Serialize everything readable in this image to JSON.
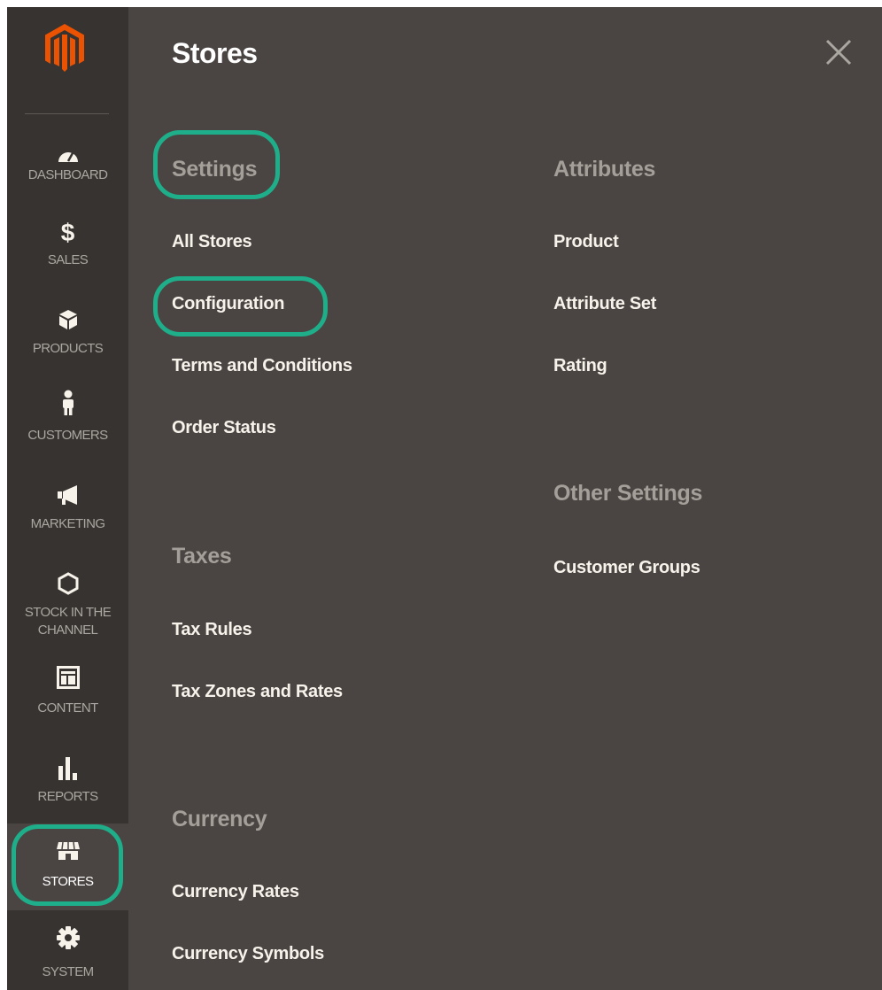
{
  "sidebar": {
    "logo_name": "magento-logo",
    "items": [
      {
        "label": "DASHBOARD",
        "icon": "dashboard-icon"
      },
      {
        "label": "SALES",
        "icon": "dollar-icon"
      },
      {
        "label": "PRODUCTS",
        "icon": "cube-icon"
      },
      {
        "label": "CUSTOMERS",
        "icon": "person-icon"
      },
      {
        "label": "MARKETING",
        "icon": "megaphone-icon"
      },
      {
        "label_line1": "STOCK IN THE",
        "label_line2": "CHANNEL",
        "icon": "hexagon-icon"
      },
      {
        "label": "CONTENT",
        "icon": "layout-icon"
      },
      {
        "label": "REPORTS",
        "icon": "bar-chart-icon"
      },
      {
        "label": "STORES",
        "icon": "store-icon",
        "active": true
      },
      {
        "label": "SYSTEM",
        "icon": "gear-icon"
      }
    ]
  },
  "panel": {
    "title": "Stores",
    "close_icon": "close-icon",
    "columns": {
      "left": [
        {
          "heading": "Settings",
          "links": [
            "All Stores",
            "Configuration",
            "Terms and Conditions",
            "Order Status"
          ]
        },
        {
          "heading": "Taxes",
          "links": [
            "Tax Rules",
            "Tax Zones and Rates"
          ]
        },
        {
          "heading": "Currency",
          "links": [
            "Currency Rates",
            "Currency Symbols"
          ]
        }
      ],
      "right": [
        {
          "heading": "Attributes",
          "links": [
            "Product",
            "Attribute Set",
            "Rating"
          ]
        },
        {
          "heading": "Other Settings",
          "links": [
            "Customer Groups"
          ]
        }
      ]
    }
  },
  "colors": {
    "sidebar_bg": "#373330",
    "panel_bg": "#4a4542",
    "highlight": "#1fae8a",
    "logo_orange": "#eb5202"
  }
}
